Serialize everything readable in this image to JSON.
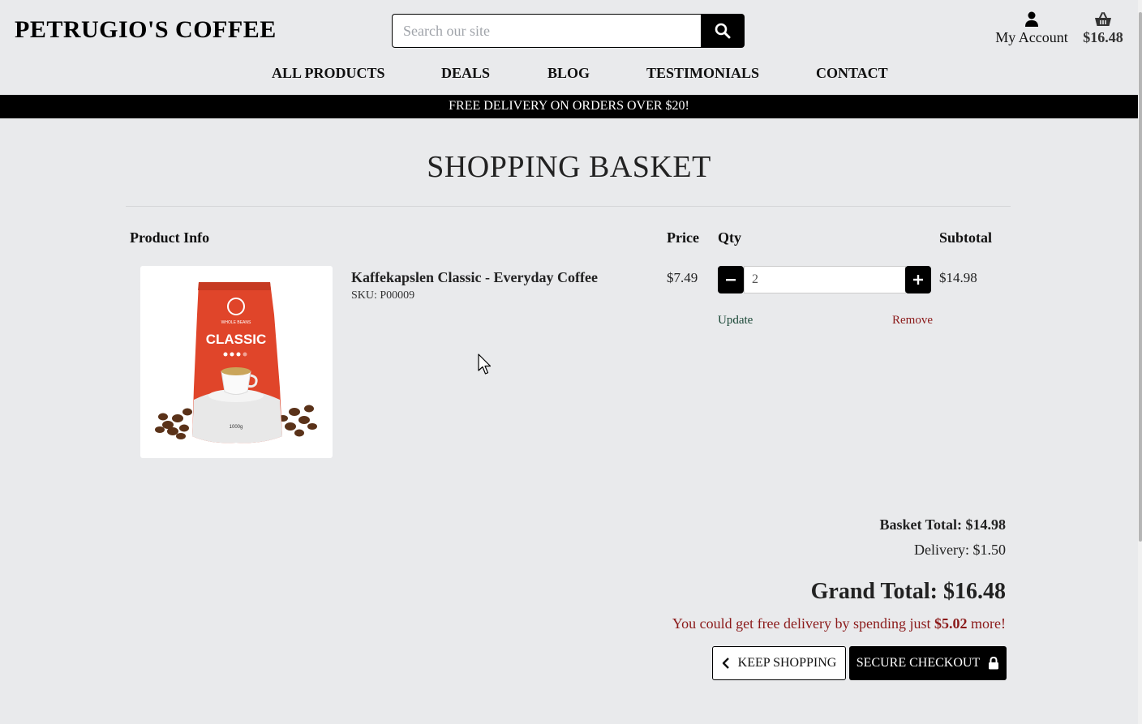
{
  "header": {
    "logo": "PETRUGIO'S COFFEE",
    "search_placeholder": "Search our site",
    "account_label": "My Account",
    "basket_total": "$16.48"
  },
  "nav": {
    "items": [
      {
        "label": "ALL PRODUCTS"
      },
      {
        "label": "DEALS"
      },
      {
        "label": "BLOG"
      },
      {
        "label": "TESTIMONIALS"
      },
      {
        "label": "CONTACT"
      }
    ]
  },
  "banner": {
    "text": "FREE DELIVERY ON ORDERS OVER $20!"
  },
  "page": {
    "title": "SHOPPING BASKET"
  },
  "table": {
    "headers": {
      "product": "Product Info",
      "price": "Price",
      "qty": "Qty",
      "subtotal": "Subtotal"
    },
    "items": [
      {
        "name": "Kaffekapslen Classic - Everyday Coffee",
        "sku": "SKU: P00009",
        "price": "$7.49",
        "qty": "2",
        "update_label": "Update",
        "remove_label": "Remove",
        "subtotal": "$14.98",
        "image_text": {
          "brand": "CLASSIC",
          "small": "WHOLE BEANS",
          "weight": "1000g"
        }
      }
    ]
  },
  "totals": {
    "basket_total": "Basket Total: $14.98",
    "delivery": "Delivery: $1.50",
    "grand_total": "Grand Total: $16.48",
    "free_msg_prefix": "You could get free delivery by spending just ",
    "free_msg_amount": "$5.02",
    "free_msg_suffix": " more!"
  },
  "buttons": {
    "keep_shopping": "KEEP SHOPPING",
    "secure_checkout": "SECURE CHECKOUT"
  },
  "colors": {
    "background": "#e9eaec",
    "primary": "#000000",
    "update_link": "#1a4736",
    "remove_link": "#8b1a1a",
    "free_msg": "#8b1a1a",
    "bag_red": "#e0452a"
  },
  "icons": {
    "search": "search-icon",
    "account": "user-icon",
    "basket": "basket-icon",
    "minus": "minus-icon",
    "plus": "plus-icon",
    "keep_shopping": "chevron-left-icon",
    "checkout": "lock-icon"
  }
}
